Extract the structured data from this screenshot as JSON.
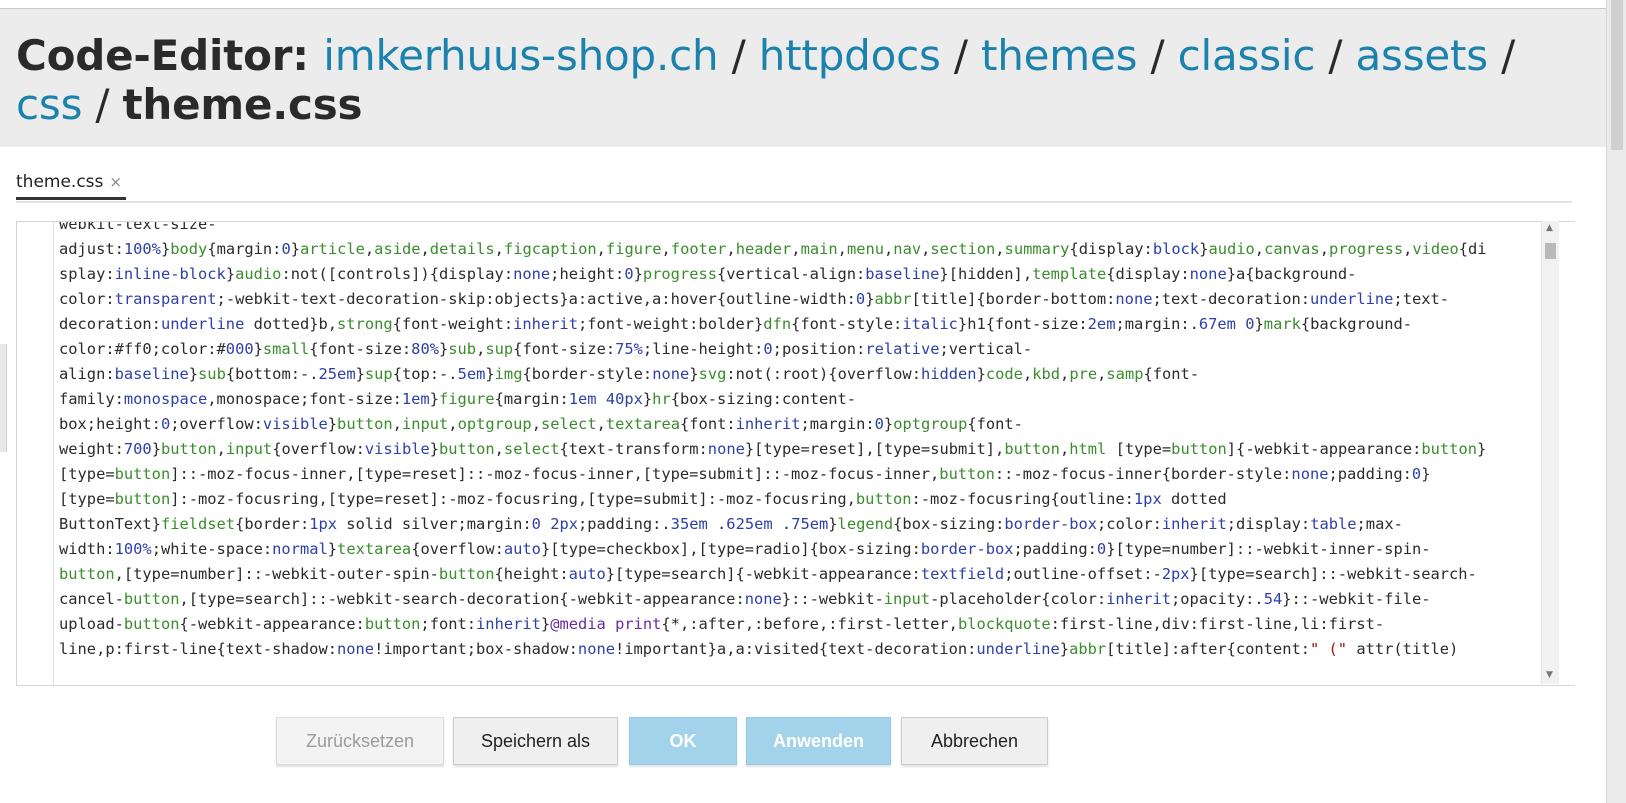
{
  "header": {
    "prefix": "Code-Editor: ",
    "breadcrumbs": [
      "imkerhuus-shop.ch",
      "httpdocs",
      "themes",
      "classic",
      "assets",
      "css"
    ],
    "separator": " / ",
    "filename": "theme.css"
  },
  "tab": {
    "label": "theme.css",
    "close_glyph": "×"
  },
  "buttons": {
    "reset": "Zurücksetzen",
    "save_as": "Speichern als",
    "ok": "OK",
    "apply": "Anwenden",
    "cancel": "Abbrechen"
  },
  "colors": {
    "link": "#1b82ad",
    "primary_button": "#a3d3eb",
    "header_bg": "#ececec"
  },
  "icons": {
    "tab_close": "close-icon",
    "scroll_up": "chevron-up-icon",
    "scroll_down": "chevron-down-icon"
  },
  "code": {
    "lines": [
      "webkit-text-size-",
      "adjust:100%}body{margin:0}article,aside,details,figcaption,figure,footer,header,main,menu,nav,section,summary{display:block}audio,canvas,progress,video{di",
      "splay:inline-block}audio:not([controls]){display:none;height:0}progress{vertical-align:baseline}[hidden],template{display:none}a{background-",
      "color:transparent;-webkit-text-decoration-skip:objects}a:active,a:hover{outline-width:0}abbr[title]{border-bottom:none;text-decoration:underline;text-",
      "decoration:underline dotted}b,strong{font-weight:inherit;font-weight:bolder}dfn{font-style:italic}h1{font-size:2em;margin:.67em 0}mark{background-",
      "color:#ff0;color:#000}small{font-size:80%}sub,sup{font-size:75%;line-height:0;position:relative;vertical-",
      "align:baseline}sub{bottom:-.25em}sup{top:-.5em}img{border-style:none}svg:not(:root){overflow:hidden}code,kbd,pre,samp{font-",
      "family:monospace,monospace;font-size:1em}figure{margin:1em 40px}hr{box-sizing:content-",
      "box;height:0;overflow:visible}button,input,optgroup,select,textarea{font:inherit;margin:0}optgroup{font-",
      "weight:700}button,input{overflow:visible}button,select{text-transform:none}[type=reset],[type=submit],button,html [type=button]{-webkit-appearance:button}",
      "[type=button]::-moz-focus-inner,[type=reset]::-moz-focus-inner,[type=submit]::-moz-focus-inner,button::-moz-focus-inner{border-style:none;padding:0}",
      "[type=button]:-moz-focusring,[type=reset]:-moz-focusring,[type=submit]:-moz-focusring,button:-moz-focusring{outline:1px dotted",
      "ButtonText}fieldset{border:1px solid silver;margin:0 2px;padding:.35em .625em .75em}legend{box-sizing:border-box;color:inherit;display:table;max-",
      "width:100%;white-space:normal}textarea{overflow:auto}[type=checkbox],[type=radio]{box-sizing:border-box;padding:0}[type=number]::-webkit-inner-spin-",
      "button,[type=number]::-webkit-outer-spin-button{height:auto}[type=search]{-webkit-appearance:textfield;outline-offset:-2px}[type=search]::-webkit-search-",
      "cancel-button,[type=search]::-webkit-search-decoration{-webkit-appearance:none}::-webkit-input-placeholder{color:inherit;opacity:.54}::-webkit-file-",
      "upload-button{-webkit-appearance:button;font:inherit}@media print{*,:after,:before,:first-letter,blockquote:first-line,div:first-line,li:first-",
      "line,p:first-line{text-shadow:none!important;box-shadow:none!important}a,a:visited{text-decoration:underline}abbr[title]:after{content:\" (\" attr(title)"
    ]
  }
}
